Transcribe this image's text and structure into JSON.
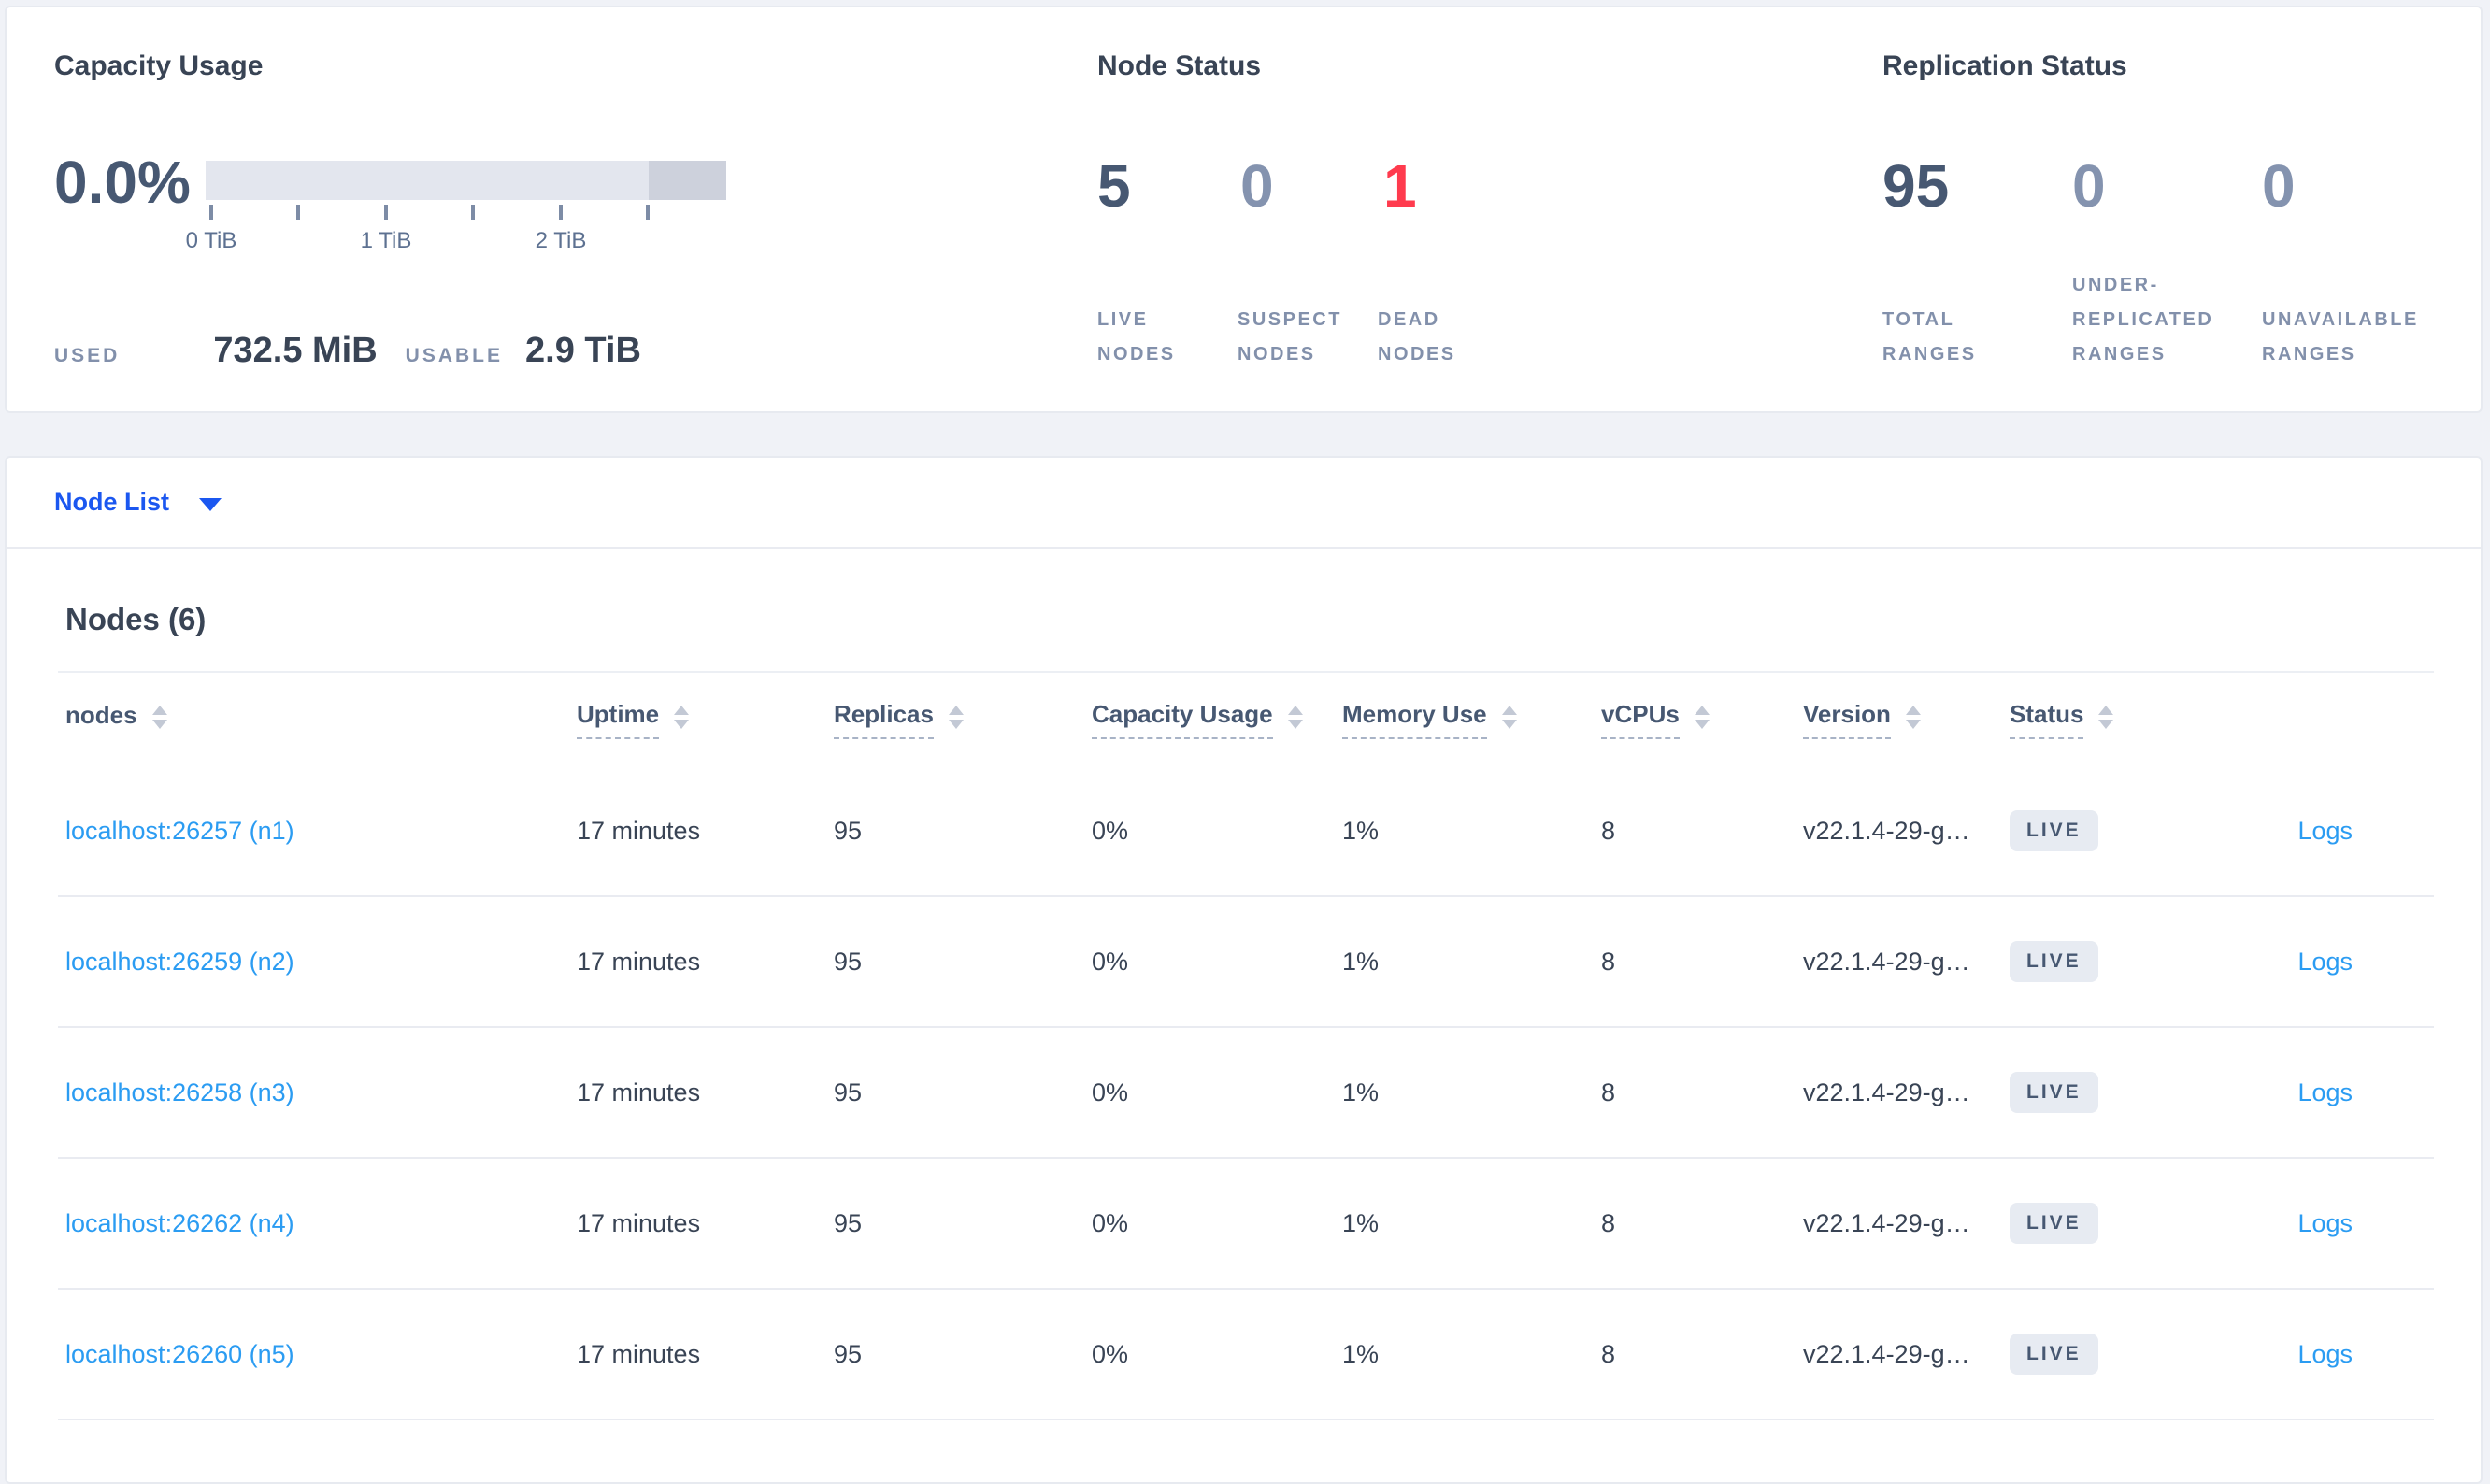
{
  "capacity": {
    "title": "Capacity Usage",
    "percent": "0.0%",
    "tick_labels": [
      "0 TiB",
      "1 TiB",
      "2 TiB"
    ],
    "used_label": "USED",
    "used_value": "732.5 MiB",
    "usable_label": "USABLE",
    "usable_value": "2.9 TiB"
  },
  "node_status": {
    "title": "Node Status",
    "stats": [
      {
        "value": "5",
        "label": "LIVE NODES"
      },
      {
        "value": "0",
        "label": "SUSPECT NODES"
      },
      {
        "value": "1",
        "label": "DEAD NODES"
      }
    ]
  },
  "replication_status": {
    "title": "Replication Status",
    "stats": [
      {
        "value": "95",
        "label": "TOTAL RANGES"
      },
      {
        "value": "0",
        "label": "UNDER-REPLICATED RANGES"
      },
      {
        "value": "0",
        "label": "UNAVAILABLE RANGES"
      }
    ]
  },
  "node_list": {
    "label": "Node List"
  },
  "nodes_table": {
    "heading": "Nodes (6)",
    "columns": {
      "nodes": "nodes",
      "uptime": "Uptime",
      "replicas": "Replicas",
      "capacity": "Capacity Usage",
      "memory": "Memory Use",
      "vcpus": "vCPUs",
      "version": "Version",
      "status": "Status"
    },
    "rows": [
      {
        "address": "localhost:26257 (n1)",
        "uptime": "17 minutes",
        "replicas": "95",
        "capacity": "0%",
        "memory": "1%",
        "vcpus": "8",
        "version": "v22.1.4-29-g…",
        "status": "LIVE",
        "logs": "Logs"
      },
      {
        "address": "localhost:26259 (n2)",
        "uptime": "17 minutes",
        "replicas": "95",
        "capacity": "0%",
        "memory": "1%",
        "vcpus": "8",
        "version": "v22.1.4-29-g…",
        "status": "LIVE",
        "logs": "Logs"
      },
      {
        "address": "localhost:26258 (n3)",
        "uptime": "17 minutes",
        "replicas": "95",
        "capacity": "0%",
        "memory": "1%",
        "vcpus": "8",
        "version": "v22.1.4-29-g…",
        "status": "LIVE",
        "logs": "Logs"
      },
      {
        "address": "localhost:26262 (n4)",
        "uptime": "17 minutes",
        "replicas": "95",
        "capacity": "0%",
        "memory": "1%",
        "vcpus": "8",
        "version": "v22.1.4-29-g…",
        "status": "LIVE",
        "logs": "Logs"
      },
      {
        "address": "localhost:26260 (n5)",
        "uptime": "17 minutes",
        "replicas": "95",
        "capacity": "0%",
        "memory": "1%",
        "vcpus": "8",
        "version": "v22.1.4-29-g…",
        "status": "LIVE",
        "logs": "Logs"
      }
    ]
  },
  "colors": {
    "stat_dark": "#475872",
    "stat_muted": "#8493af",
    "stat_dead_red": "#ff3b4e",
    "link_blue": "#2b9cf2",
    "dropdown_blue": "#1b57f0",
    "badge_background": "#e7ebf2",
    "page_background": "#f0f2f7"
  }
}
